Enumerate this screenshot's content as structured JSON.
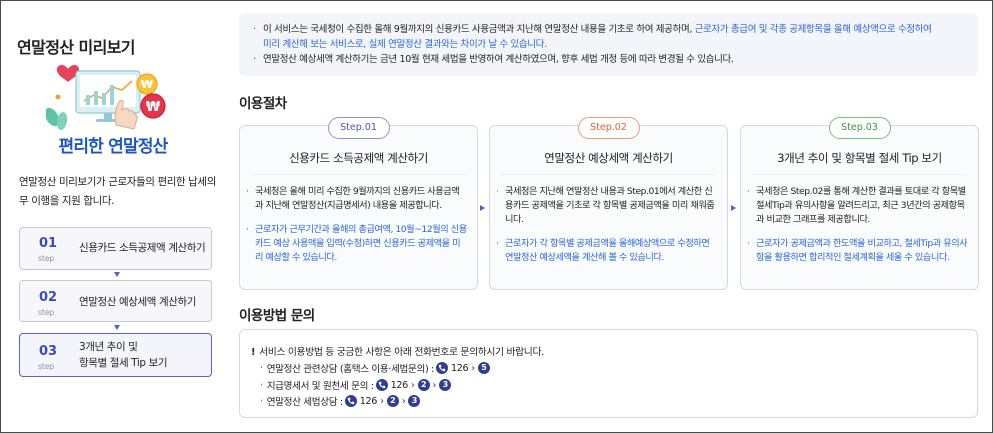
{
  "sidebar": {
    "title": "연말정산 미리보기",
    "hero_caption": "편리한 연말정산",
    "description": "연말정산 미리보기가 근로자들의  편리한 납세의무 이행을 지원 합니다.",
    "steps": [
      {
        "num": "01",
        "step": "step",
        "label": "신용카드 소득공제액 계산하기"
      },
      {
        "num": "02",
        "step": "step",
        "label": "연말정산 예상세액 계산하기"
      },
      {
        "num": "03",
        "step": "step",
        "label_line1": "3개년 추이 및",
        "label_line2": "항목별 절세 Tip 보기"
      }
    ]
  },
  "notice": {
    "line1_a": "이 서비스는 국세청이 수집한 올해 9월까지의 신용카드 사용금액과 지난해 연말정산 내용을 기초로 하여 제공하며, ",
    "line1_b": "근로자가 총급여 및 각종 공제항목을 올해 예상액으로 수정하여",
    "line1_c": "미리 계산해 보는 서비스로, 실제 연말정산 결과와는 차이가 날 수 있습니다.",
    "line2": "연말정산 예상세액 계산하기는 금년 10월 현재 세법을 반영하여 계산하였으며, 향후 세법 개정 등에 따라 변경될 수 있습니다."
  },
  "procedure": {
    "title": "이용절차",
    "cards": [
      {
        "pill": "Step.01",
        "title": "신용카드 소득공제액 계산하기",
        "text1": "국세청은 올해 미리 수집한 9월까지의 신용카드 사용금액과 지난해 연말정산(지급명세서) 내용을 제공합니다.",
        "text2": "근로자가 근무기간과 올해의 총급여액, 10월~12월의 신용카드 예상 사용액을 입력(수정)하면 신용카드 공제액을 미리 예상할 수 있습니다."
      },
      {
        "pill": "Step.02",
        "title": "연말정산 예상세액 계산하기",
        "text1": "국세청은 지난해 연말정산 내용과 Step.01에서 계산한 신용카드 공제액을 기초로 각 항목별 공제금액을 미리 채워줍니다.",
        "text2": "근로자가 각 항목별 공제금액을 올해예상액으로 수정하면 연말정산 예상세액을 계산해 볼 수 있습니다."
      },
      {
        "pill": "Step.03",
        "title": "3개년 추이 및 항목별 절세 Tip 보기",
        "text1": "국세청은 Step.02를 통해 계산한 결과를 토대로 각 항목별 절세Tip과 유의사항을 알려드리고, 최근 3년간의 공제항목과 비교한 그래프를 제공합니다.",
        "text2": "근로자가 공제금액과 한도액을 비교하고, 절세Tip과 유의사항을 활용하면 합리적인 절세계획을 세울 수 있습니다."
      }
    ]
  },
  "inquiry": {
    "title": "이용방법 문의",
    "bang": "!",
    "head": "서비스 이용방법 등 궁금한 사항은 아래 전화번호로 문의하시기 바랍니다.",
    "lines": [
      {
        "label": "연말정산 관련상담 (홈택스 이용·세법문의) :",
        "number": "126",
        "steps": [
          "5"
        ]
      },
      {
        "label": "지급명세서 및 원천세 문의 :",
        "number": "126",
        "steps": [
          "2",
          "3"
        ]
      },
      {
        "label": "연말정산 세법상담 :",
        "number": "126",
        "steps": [
          "2",
          "3"
        ]
      }
    ]
  },
  "colors": {
    "accent": "#2a66d8",
    "step_num": "#3a4db6",
    "step1": "#8b92d6",
    "step2": "#f19a80",
    "step3": "#72c077"
  }
}
